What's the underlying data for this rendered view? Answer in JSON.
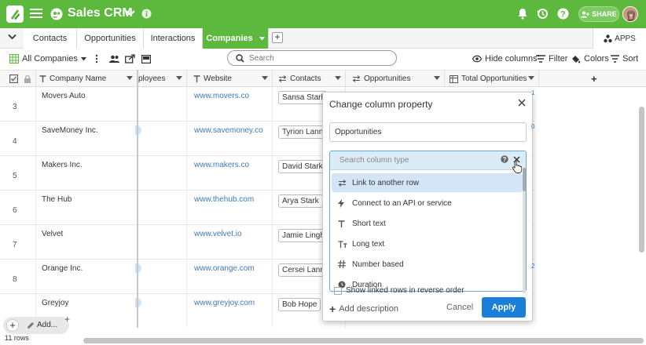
{
  "topbar": {
    "title": "Sales CRM",
    "share_label": "SHARE",
    "bg_color": "#5cb93e"
  },
  "tabs": [
    {
      "label": "Contacts"
    },
    {
      "label": "Opportunities"
    },
    {
      "label": "Interactions"
    },
    {
      "label": "Companies",
      "active": true
    }
  ],
  "apps_label": "APPS",
  "toolbar": {
    "view_name": "All Companies",
    "search_placeholder": "Search",
    "hide_columns": "Hide columns",
    "filter": "Filter",
    "colors": "Colors",
    "sort": "Sort"
  },
  "columns": {
    "company": "Company Name",
    "employees": "ployees",
    "website": "Website",
    "contacts": "Contacts",
    "opportunities": "Opportunities",
    "total_opportunities": "Total Opportunities"
  },
  "rows": [
    {
      "num": "3",
      "company": "Movers Auto",
      "website": "www.movers.co",
      "contact": "Sansa Stark"
    },
    {
      "num": "4",
      "company": "SaveMoney Inc.",
      "website": "www.savemoney.co",
      "contact": "Tyrion Lannis"
    },
    {
      "num": "5",
      "company": "Makers Inc.",
      "website": "www.makers.co",
      "contact": "David Stark"
    },
    {
      "num": "6",
      "company": "The Hub",
      "website": "www.thehub.com",
      "contact": "Arya Stark"
    },
    {
      "num": "7",
      "company": "Velvet",
      "website": "www.velvet.io",
      "contact": "Jamie Lingha"
    },
    {
      "num": "8",
      "company": "Orange Inc.",
      "website": "www.orange.com",
      "contact": "Cersei Lannis"
    },
    {
      "num": "",
      "company": "Greyjoy",
      "website": "www.greyjoy.com",
      "contact": "Bob Hope"
    }
  ],
  "footer": {
    "row_count": "11 rows",
    "add_label": "Add..."
  },
  "dialog": {
    "title": "Change column property",
    "column_name": "Opportunities",
    "search_placeholder": "Search column type",
    "options": [
      {
        "label": "Link to another row",
        "icon": "link-icon",
        "selected": true
      },
      {
        "label": "Connect to an API or service",
        "icon": "bolt-icon"
      },
      {
        "label": "Short text",
        "icon": "short-text-icon"
      },
      {
        "label": "Long text",
        "icon": "long-text-icon"
      },
      {
        "label": "Number based",
        "icon": "hash-icon"
      },
      {
        "label": "Duration",
        "icon": "clock-icon"
      }
    ],
    "reverse_label": "Show linked rows in reverse order",
    "add_description": "Add description",
    "cancel": "Cancel",
    "apply": "Apply",
    "apply_color": "#1a7fd8"
  }
}
